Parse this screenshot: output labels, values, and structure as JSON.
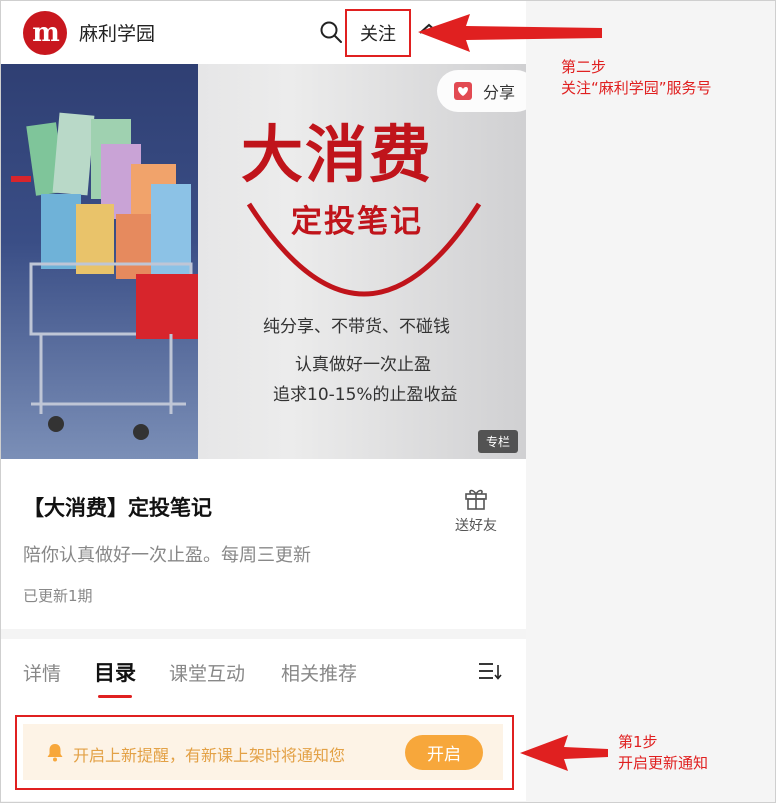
{
  "header": {
    "logo_text": "m",
    "brand": "麻利学园",
    "follow_label": "关注"
  },
  "banner": {
    "title": "大消费",
    "subtitle": "定投笔记",
    "line1": "纯分享、不带货、不碰钱",
    "line2": "认真做好一次止盈",
    "line3": "追求10-15%的止盈收益",
    "share_label": "分享",
    "column_tag": "专栏"
  },
  "course": {
    "title": "【大消费】定投笔记",
    "description": "陪你认真做好一次止盈。每周三更新",
    "updates": "已更新1期",
    "gift_label": "送好友"
  },
  "tabs": [
    {
      "label": "详情",
      "active": false
    },
    {
      "label": "目录",
      "active": true
    },
    {
      "label": "课堂互动",
      "active": false
    },
    {
      "label": "相关推荐",
      "active": false
    }
  ],
  "notify": {
    "text": "开启上新提醒，有新课上架时将通知您",
    "button": "开启"
  },
  "annotations": {
    "step2_title": "第二步",
    "step2_text": "关注“麻利学园”服务号",
    "step1_title": "第1步",
    "step1_text": "开启更新通知"
  },
  "colors": {
    "accent_red": "#e02020",
    "brand_red": "#c8171e",
    "notify_orange": "#f7a73b",
    "notify_bg": "#fdf3e6"
  }
}
